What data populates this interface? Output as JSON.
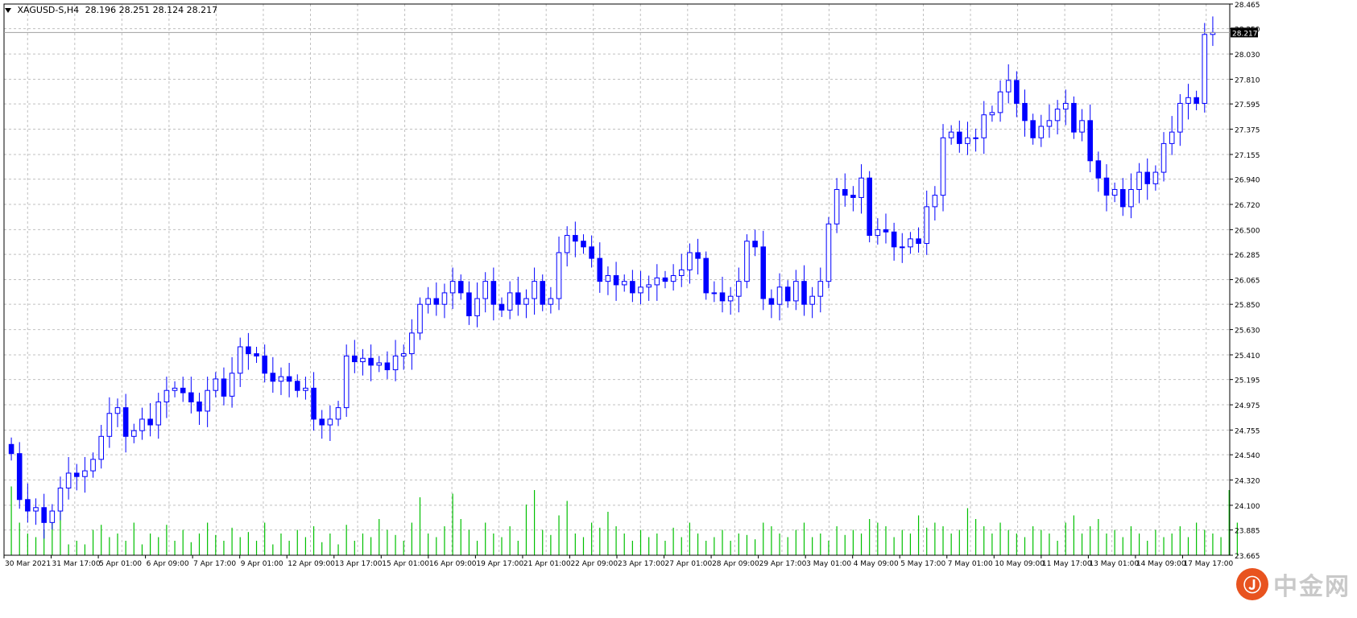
{
  "header": {
    "symbol": "XAGUSD-S,H4",
    "ohlc": "28.196 28.251 28.124 28.217"
  },
  "watermark": {
    "brand": "中金网",
    "logo_mark": "Ⓙ"
  },
  "colors": {
    "bull": "#0000ff",
    "bear": "#0000ff",
    "volume": "#00c000",
    "grid": "#c0c0c0",
    "price_label_bg": "#000000",
    "price_label_fg": "#ffffff",
    "border": "#000000"
  },
  "chart_data": {
    "type": "candlestick",
    "symbol": "XAGUSD-S",
    "timeframe": "H4",
    "last_price": "28.217",
    "y_ticks": [
      "28.465",
      "28.250",
      "28.030",
      "27.810",
      "27.595",
      "27.375",
      "27.155",
      "26.940",
      "26.720",
      "26.500",
      "26.285",
      "26.065",
      "25.850",
      "25.630",
      "25.410",
      "25.195",
      "24.975",
      "24.755",
      "24.540",
      "24.320",
      "24.100",
      "23.885",
      "23.665"
    ],
    "ylim": [
      23.665,
      28.465
    ],
    "x_labels": [
      "30 Mar 2021",
      "31 Mar 17:00",
      "5 Apr 01:00",
      "6 Apr 09:00",
      "7 Apr 17:00",
      "9 Apr 01:00",
      "12 Apr 09:00",
      "13 Apr 17:00",
      "15 Apr 01:00",
      "16 Apr 09:00",
      "19 Apr 17:00",
      "21 Apr 01:00",
      "22 Apr 09:00",
      "23 Apr 17:00",
      "27 Apr 01:00",
      "28 Apr 09:00",
      "29 Apr 17:00",
      "3 May 01:00",
      "4 May 09:00",
      "5 May 17:00",
      "7 May 01:00",
      "10 May 09:00",
      "11 May 17:00",
      "13 May 01:00",
      "14 May 09:00",
      "17 May 17:00"
    ],
    "closes": [
      24.55,
      24.15,
      24.05,
      24.08,
      23.95,
      24.05,
      24.25,
      24.38,
      24.35,
      24.4,
      24.5,
      24.7,
      24.9,
      24.95,
      24.7,
      24.75,
      24.85,
      24.8,
      25.0,
      25.1,
      25.12,
      25.08,
      25.0,
      24.92,
      25.1,
      25.2,
      25.05,
      25.25,
      25.48,
      25.42,
      25.4,
      25.25,
      25.18,
      25.22,
      25.18,
      25.1,
      25.12,
      24.85,
      24.8,
      24.85,
      24.95,
      25.4,
      25.35,
      25.38,
      25.32,
      25.34,
      25.28,
      25.4,
      25.42,
      25.6,
      25.85,
      25.9,
      25.85,
      25.95,
      26.05,
      25.95,
      25.75,
      25.9,
      26.05,
      25.85,
      25.8,
      25.95,
      25.85,
      25.9,
      26.05,
      25.85,
      25.9,
      26.3,
      26.45,
      26.4,
      26.35,
      26.25,
      26.05,
      26.1,
      26.02,
      26.05,
      25.95,
      26.0,
      26.02,
      26.08,
      26.05,
      26.1,
      26.15,
      26.3,
      26.25,
      25.95,
      25.95,
      25.88,
      25.92,
      26.05,
      26.4,
      26.35,
      25.9,
      25.85,
      26.0,
      25.88,
      26.05,
      25.85,
      25.92,
      26.05,
      26.55,
      26.85,
      26.8,
      26.78,
      26.95,
      26.45,
      26.5,
      26.48,
      26.35,
      26.35,
      26.42,
      26.38,
      26.7,
      26.8,
      27.3,
      27.35,
      27.25,
      27.3,
      27.3,
      27.5,
      27.52,
      27.7,
      27.8,
      27.6,
      27.45,
      27.3,
      27.4,
      27.45,
      27.55,
      27.6,
      27.35,
      27.45,
      27.1,
      26.95,
      26.8,
      26.85,
      26.7,
      26.85,
      27.0,
      26.9,
      27.0,
      27.25,
      27.35,
      27.6,
      27.65,
      27.6,
      28.2,
      28.217
    ],
    "volumes": [
      0.95,
      0.45,
      0.3,
      0.25,
      0.35,
      0.5,
      0.6,
      0.15,
      0.2,
      0.15,
      0.35,
      0.42,
      0.25,
      0.3,
      0.2,
      0.45,
      0.15,
      0.3,
      0.25,
      0.42,
      0.2,
      0.35,
      0.18,
      0.3,
      0.45,
      0.28,
      0.2,
      0.38,
      0.25,
      0.32,
      0.2,
      0.45,
      0.15,
      0.3,
      0.2,
      0.35,
      0.25,
      0.4,
      0.18,
      0.3,
      0.15,
      0.42,
      0.2,
      0.3,
      0.25,
      0.5,
      0.35,
      0.28,
      0.2,
      0.45,
      0.8,
      0.3,
      0.25,
      0.4,
      0.85,
      0.5,
      0.35,
      0.2,
      0.45,
      0.3,
      0.25,
      0.4,
      0.2,
      0.7,
      0.9,
      0.35,
      0.28,
      0.55,
      0.75,
      0.3,
      0.25,
      0.45,
      0.38,
      0.6,
      0.4,
      0.3,
      0.2,
      0.35,
      0.25,
      0.3,
      0.2,
      0.38,
      0.25,
      0.45,
      0.3,
      0.2,
      0.25,
      0.35,
      0.2,
      0.3,
      0.28,
      0.22,
      0.45,
      0.4,
      0.3,
      0.25,
      0.35,
      0.45,
      0.25,
      0.3,
      0.2,
      0.4,
      0.28,
      0.35,
      0.3,
      0.5,
      0.45,
      0.4,
      0.25,
      0.35,
      0.3,
      0.55,
      0.38,
      0.45,
      0.4,
      0.3,
      0.35,
      0.65,
      0.5,
      0.4,
      0.3,
      0.45,
      0.35,
      0.3,
      0.25,
      0.4,
      0.35,
      0.3,
      0.2,
      0.45,
      0.55,
      0.3,
      0.4,
      0.5,
      0.3,
      0.35,
      0.25,
      0.4,
      0.3,
      0.2,
      0.35,
      0.25,
      0.3,
      0.4,
      0.25,
      0.45,
      0.35,
      0.3,
      0.25,
      0.9,
      0.45
    ]
  }
}
